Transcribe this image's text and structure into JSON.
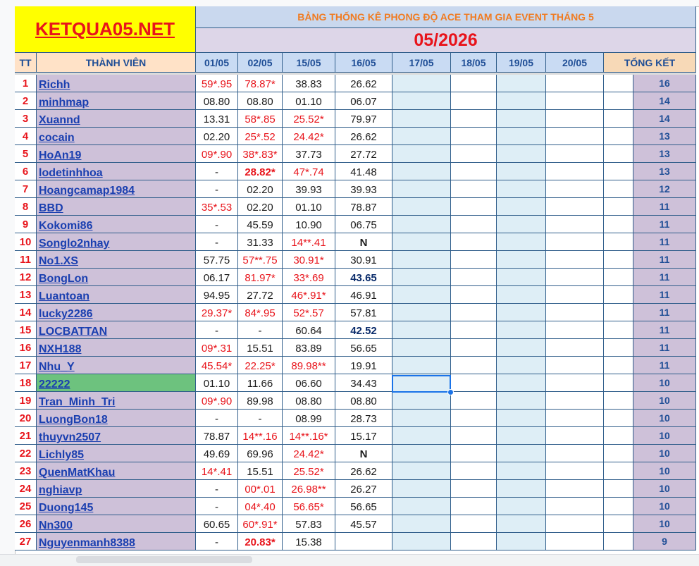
{
  "logo": "KETQUA05.NET",
  "banner": {
    "title": "BẢNG THỐNG KÊ PHONG ĐỘ ACE THAM GIA EVENT THÁNG 5",
    "date": "05/2026"
  },
  "headers": {
    "tt": "TT",
    "member": "THÀNH VIÊN",
    "dates": [
      "01/05",
      "02/05",
      "15/05",
      "16/05",
      "17/05",
      "18/05",
      "19/05",
      "20/05"
    ],
    "total": "TỔNG KẾT"
  },
  "rows": [
    {
      "tt": "1",
      "name": "Richh",
      "d": [
        "59*.95",
        "78.87*",
        "38.83",
        "26.62"
      ],
      "total": "16"
    },
    {
      "tt": "2",
      "name": "minhmap",
      "d": [
        "08.80",
        "08.80",
        "01.10",
        "06.07"
      ],
      "total": "14"
    },
    {
      "tt": "3",
      "name": "Xuannd",
      "d": [
        "13.31",
        "58*.85",
        "25.52*",
        "79.97"
      ],
      "total": "14"
    },
    {
      "tt": "4",
      "name": "cocain",
      "d": [
        "02.20",
        "25*.52",
        "24.42*",
        "26.62"
      ],
      "total": "13"
    },
    {
      "tt": "5",
      "name": "HoAn19",
      "d": [
        "09*.90",
        "38*.83*",
        "37.73",
        "27.72"
      ],
      "total": "13"
    },
    {
      "tt": "6",
      "name": "lodetinhhoa",
      "d": [
        "-",
        "28.82*",
        "47*.74",
        "41.48"
      ],
      "total": "13"
    },
    {
      "tt": "7",
      "name": "Hoangcamap1984",
      "d": [
        "-",
        "02.20",
        "39.93",
        "39.93"
      ],
      "total": "12"
    },
    {
      "tt": "8",
      "name": "BBD",
      "d": [
        "35*.53",
        "02.20",
        "01.10",
        "78.87"
      ],
      "total": "11"
    },
    {
      "tt": "9",
      "name": "Kokomi86",
      "d": [
        "-",
        "45.59",
        "10.90",
        "06.75"
      ],
      "total": "11"
    },
    {
      "tt": "10",
      "name": "Songlo2nhay",
      "d": [
        "-",
        "31.33",
        "14**.41",
        "N"
      ],
      "total": "11"
    },
    {
      "tt": "11",
      "name": "No1.XS",
      "d": [
        "57.75",
        "57**.75",
        "30.91*",
        "30.91"
      ],
      "total": "11"
    },
    {
      "tt": "12",
      "name": "BongLon",
      "d": [
        "06.17",
        "81.97*",
        "33*.69",
        "43.65"
      ],
      "total": "11"
    },
    {
      "tt": "13",
      "name": "Luantoan",
      "d": [
        "94.95",
        "27.72",
        "46*.91*",
        "46.91"
      ],
      "total": "11"
    },
    {
      "tt": "14",
      "name": "lucky2286",
      "d": [
        "29.37*",
        "84*.95",
        "52*.57",
        "57.81"
      ],
      "total": "11"
    },
    {
      "tt": "15",
      "name": "LOCBATTAN",
      "d": [
        "-",
        "-",
        "60.64",
        "42.52"
      ],
      "total": "11"
    },
    {
      "tt": "16",
      "name": "NXH188",
      "d": [
        "09*.31",
        "15.51",
        "83.89",
        "56.65"
      ],
      "total": "11"
    },
    {
      "tt": "17",
      "name": "Nhu_Y",
      "d": [
        "45.54*",
        "22.25*",
        "89.98**",
        "19.91"
      ],
      "total": "11"
    },
    {
      "tt": "18",
      "name": "22222",
      "d": [
        "01.10",
        "11.66",
        "06.60",
        "34.43"
      ],
      "total": "10"
    },
    {
      "tt": "19",
      "name": "Tran_Minh_Tri",
      "d": [
        "09*.90",
        "89.98",
        "08.80",
        "08.80"
      ],
      "total": "10"
    },
    {
      "tt": "20",
      "name": "LuongBon18",
      "d": [
        "-",
        "-",
        "08.99",
        "28.73"
      ],
      "total": "10"
    },
    {
      "tt": "21",
      "name": "thuyvn2507",
      "d": [
        "78.87",
        "14**.16",
        "14**.16*",
        "15.17"
      ],
      "total": "10"
    },
    {
      "tt": "22",
      "name": "Lichly85",
      "d": [
        "49.69",
        "69.96",
        "24.42*",
        "N"
      ],
      "total": "10"
    },
    {
      "tt": "23",
      "name": "QuenMatKhau",
      "d": [
        "14*.41",
        "15.51",
        "25.52*",
        "26.62"
      ],
      "total": "10"
    },
    {
      "tt": "24",
      "name": "nghiavp",
      "d": [
        "-",
        "00*.01",
        "26.98**",
        "26.27"
      ],
      "total": "10"
    },
    {
      "tt": "25",
      "name": "Duong145",
      "d": [
        "-",
        "04*.40",
        "56.65*",
        "56.65"
      ],
      "total": "10"
    },
    {
      "tt": "26",
      "name": "Nn300",
      "d": [
        "60.65",
        "60*.91*",
        "57.83",
        "45.57"
      ],
      "total": "10"
    },
    {
      "tt": "27",
      "name": "Nguyenmanh8388",
      "d": [
        "-",
        "20.83*",
        "15.38",
        ""
      ],
      "total": "9"
    }
  ]
}
